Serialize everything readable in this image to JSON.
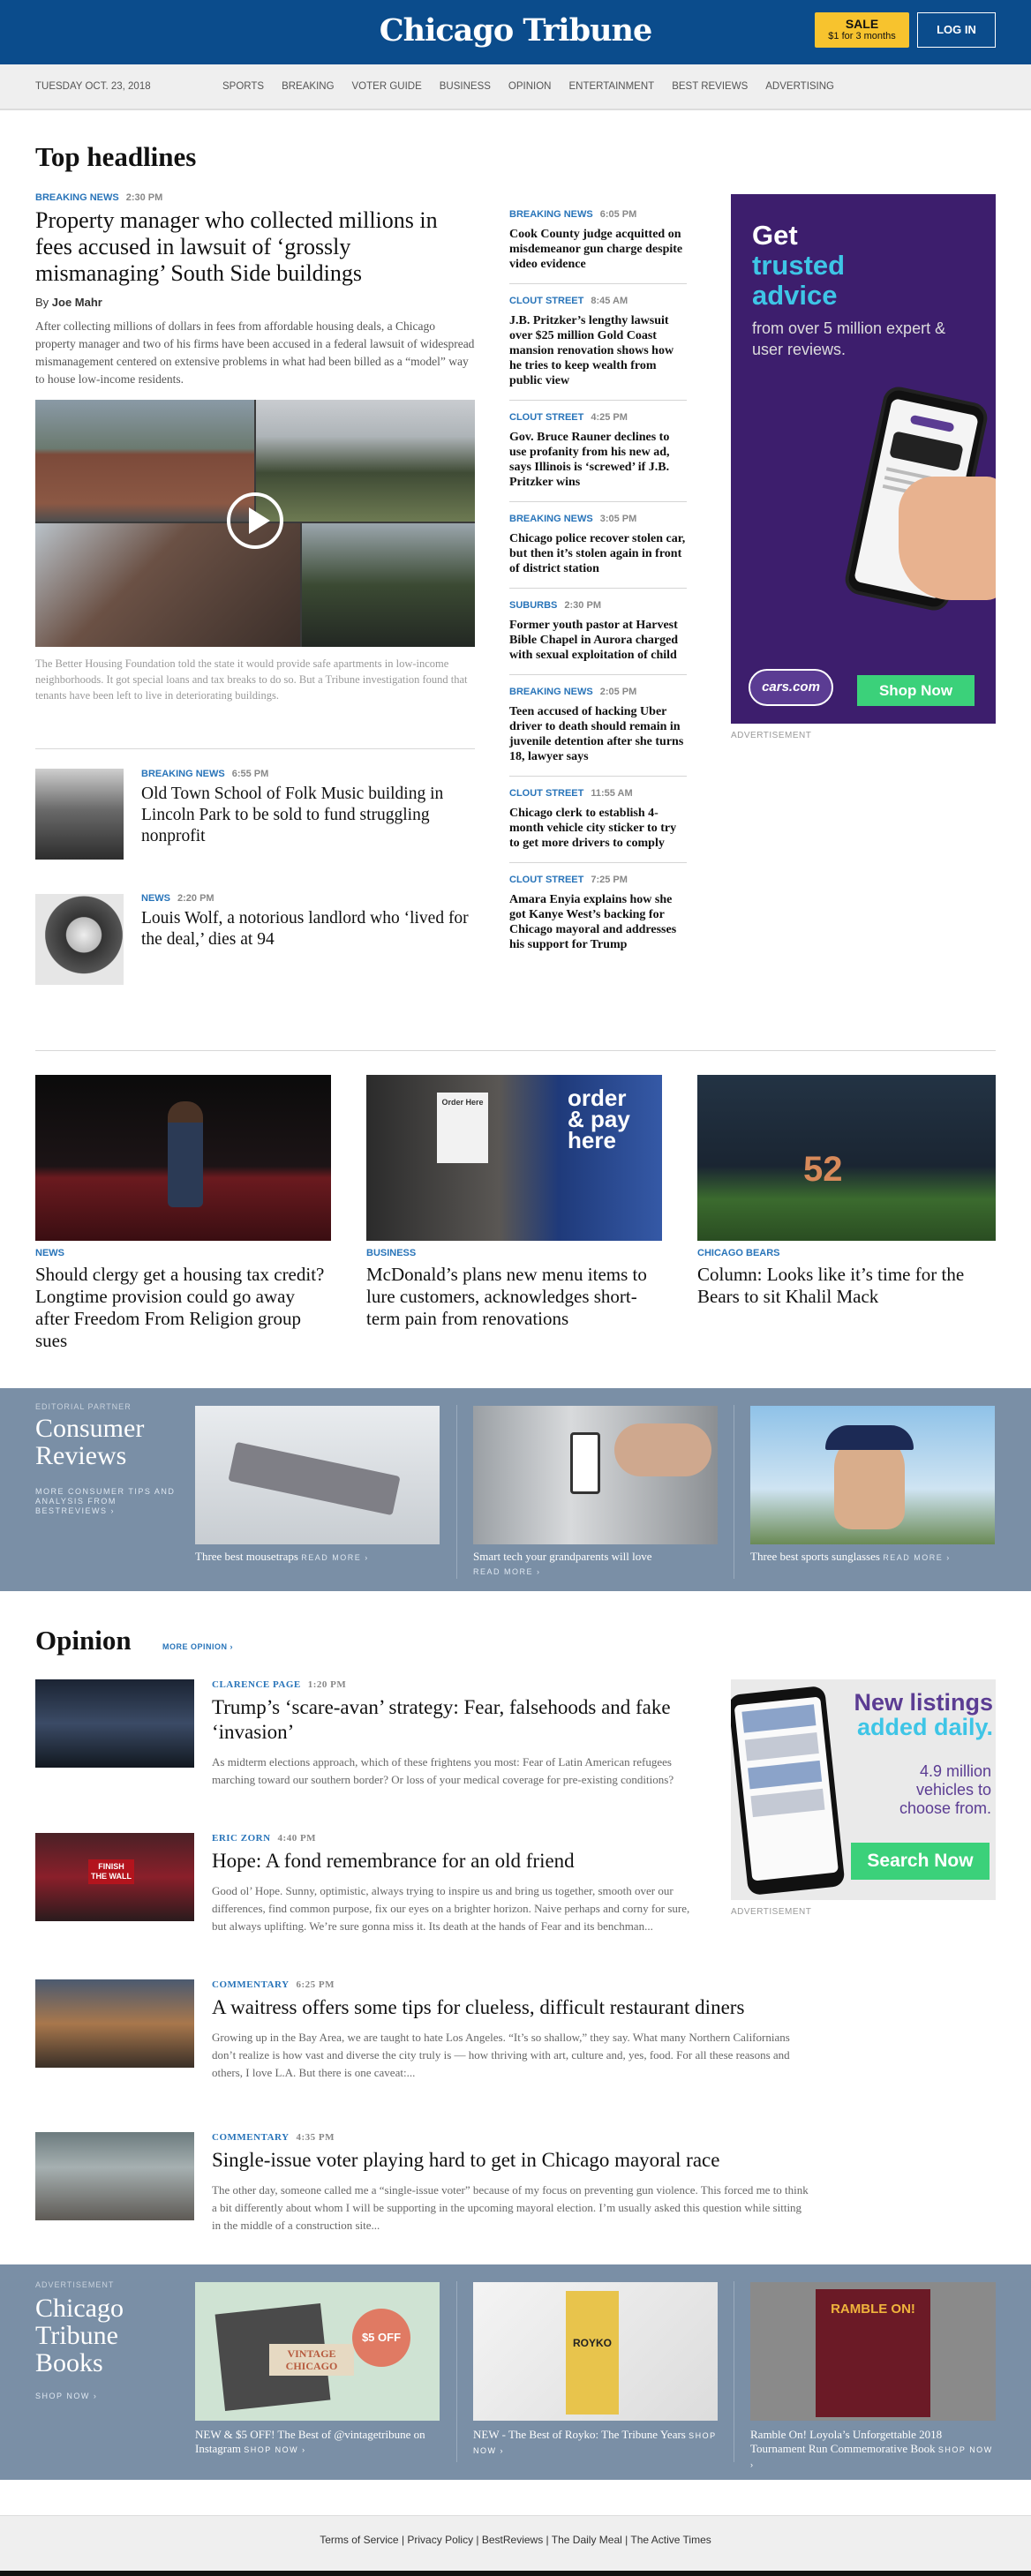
{
  "header": {
    "logo": "Chicago Tribune",
    "sale_title": "SALE",
    "sale_sub": "$1 for 3 months",
    "login": "LOG IN"
  },
  "nav": {
    "date": "TUESDAY OCT. 23, 2018",
    "items": [
      "SPORTS",
      "BREAKING",
      "VOTER GUIDE",
      "BUSINESS",
      "OPINION",
      "ENTERTAINMENT",
      "BEST REVIEWS",
      "ADVERTISING"
    ]
  },
  "top": {
    "section_title": "Top headlines",
    "lead": {
      "kicker": "BREAKING NEWS",
      "time": "2:30 PM",
      "headline": "Property manager who collected millions in fees accused in lawsuit of ‘grossly mismanaging’ South Side buildings",
      "byline_prefix": "By",
      "byline": "Joe Mahr",
      "dek": "After collecting millions of dollars in fees from affordable housing deals, a Chicago property manager and two of his firms have been accused in a federal lawsuit of widespread mismanagement centered on extensive problems in what had been billed as a “model” way to house low-income residents.",
      "caption": "The Better Housing Foundation told the state it would provide safe apartments in low-income neighborhoods. It got special loans and tax breaks to do so. But a Tribune investigation found that tenants have been left to live in deteriorating buildings."
    },
    "small": [
      {
        "kicker": "BREAKING NEWS",
        "time": "6:55 PM",
        "headline": "Old Town School of Folk Music building in Lincoln Park to be sold to fund struggling nonprofit"
      },
      {
        "kicker": "NEWS",
        "time": "2:20 PM",
        "headline": "Louis Wolf, a notorious landlord who ‘lived for the deal,’ dies at 94"
      }
    ],
    "right": [
      {
        "kicker": "BREAKING NEWS",
        "time": "6:05 PM",
        "headline": "Cook County judge acquitted on misdemeanor gun charge despite video evidence"
      },
      {
        "kicker": "CLOUT STREET",
        "time": "8:45 AM",
        "headline": "J.B. Pritzker’s lengthy lawsuit over $25 million Gold Coast mansion renovation shows how he tries to keep wealth from public view"
      },
      {
        "kicker": "CLOUT STREET",
        "time": "4:25 PM",
        "headline": "Gov. Bruce Rauner declines to use profanity from his new ad, says Illinois is ‘screwed’ if J.B. Pritzker wins"
      },
      {
        "kicker": "BREAKING NEWS",
        "time": "3:05 PM",
        "headline": "Chicago police recover stolen car, but then it’s stolen again in front of district station"
      },
      {
        "kicker": "SUBURBS",
        "time": "2:30 PM",
        "headline": "Former youth pastor at Harvest Bible Chapel in Aurora charged with sexual exploitation of child"
      },
      {
        "kicker": "BREAKING NEWS",
        "time": "2:05 PM",
        "headline": "Teen accused of hacking Uber driver to death should remain in juvenile detention after she turns 18, lawyer says"
      },
      {
        "kicker": "CLOUT STREET",
        "time": "11:55 AM",
        "headline": "Chicago clerk to establish 4-month vehicle city sticker to try to get more drivers to comply"
      },
      {
        "kicker": "CLOUT STREET",
        "time": "7:25 PM",
        "headline": "Amara Enyia explains how she got Kanye West’s backing for Chicago mayoral and addresses his support for Trump"
      }
    ]
  },
  "ad1": {
    "line1": "Get",
    "line2": "trusted",
    "line3": "advice",
    "line4": "from over 5 million expert & user reviews.",
    "brand": "cars.com",
    "cta": "Shop Now",
    "label": "ADVERTISEMENT"
  },
  "features": [
    {
      "kicker": "NEWS",
      "headline": "Should clergy get a housing tax credit? Longtime provision could go away after Freedom From Religion group sues"
    },
    {
      "kicker": "BUSINESS",
      "headline": "McDonald’s plans new menu items to lure customers, acknowledges short-term pain from renovations",
      "sign1": "Order Here",
      "sign2": "order & pay here"
    },
    {
      "kicker": "CHICAGO BEARS",
      "headline": "Column: Looks like it’s time for the Bears to sit Khalil Mack",
      "jersey": "52"
    }
  ],
  "consumer": {
    "partner": "EDITORIAL PARTNER",
    "title": "Consumer Reviews",
    "sub": "MORE CONSUMER TIPS AND ANALYSIS FROM BESTREVIEWS ›",
    "cards": [
      {
        "caption": "Three best mousetraps",
        "more": "READ MORE ›"
      },
      {
        "caption": "Smart tech your grandparents will love",
        "more": "READ MORE ›"
      },
      {
        "caption": "Three best sports sunglasses",
        "more": "READ MORE ›"
      }
    ]
  },
  "opinion": {
    "title": "Opinion",
    "more": "MORE OPINION ›",
    "items": [
      {
        "kicker": "CLARENCE PAGE",
        "time": "1:20 PM",
        "headline": "Trump’s ‘scare-avan’ strategy: Fear, falsehoods and fake ‘invasion’",
        "dek": "As midterm elections approach, which of these frightens you most: Fear of Latin American refugees marching toward our southern border? Or loss of your medical coverage for pre-existing conditions?"
      },
      {
        "kicker": "ERIC ZORN",
        "time": "4:40 PM",
        "headline": "Hope: A fond remembrance for an old friend",
        "dek": "Good ol’ Hope. Sunny, optimistic, always trying to inspire us and bring us together, smooth over our differences, find common purpose, fix our eyes on a brighter horizon. Naive perhaps and corny for sure, but always uplifting. We’re sure gonna miss it. Its death at the hands of Fear and its benchman...",
        "sign1": "FINISH THE WALL"
      },
      {
        "kicker": "COMMENTARY",
        "time": "6:25 PM",
        "headline": "A waitress offers some tips for clueless, difficult restaurant diners",
        "dek": "Growing up in the Bay Area, we are taught to hate Los Angeles. “It’s so shallow,” they say. What many Northern Californians don’t realize is how vast and diverse the city truly is — how thriving with art, culture and, yes, food. For all these reasons and others, I love L.A. But there is one caveat:..."
      },
      {
        "kicker": "COMMENTARY",
        "time": "4:35 PM",
        "headline": "Single-issue voter playing hard to get in Chicago mayoral race",
        "dek": "The other day, someone called me a “single-issue voter” because of my focus on preventing gun violence. This forced me to think a bit differently about whom I will be supporting in the upcoming mayoral election. I’m usually asked this question while sitting in the middle of a construction site..."
      }
    ]
  },
  "ad2": {
    "line1": "New listings",
    "line2": "added daily.",
    "line3": "4.9 million vehicles to choose from.",
    "cta": "Search Now",
    "label": "ADVERTISEMENT"
  },
  "books": {
    "label": "ADVERTISEMENT",
    "title": "Chicago Tribune Books",
    "shop": "SHOP NOW ›",
    "cards": [
      {
        "caption": "NEW & $5 OFF! The Best of @vintagetribune on Instagram",
        "more": "SHOP NOW ›",
        "img1": "VINTAGE CHICAGO",
        "img2": "$5 OFF"
      },
      {
        "caption": "NEW - The Best of Royko: The Tribune Years",
        "more": "SHOP NOW ›",
        "img1": "ROYKO"
      },
      {
        "caption": "Ramble On! Loyola’s Unforgettable 2018 Tournament Run Commemorative Book",
        "more": "SHOP NOW ›",
        "img1": "RAMBLE ON!"
      }
    ]
  },
  "footer": {
    "links": "Terms of Service | Privacy Policy | BestReviews | The Daily Meal | The Active Times"
  }
}
